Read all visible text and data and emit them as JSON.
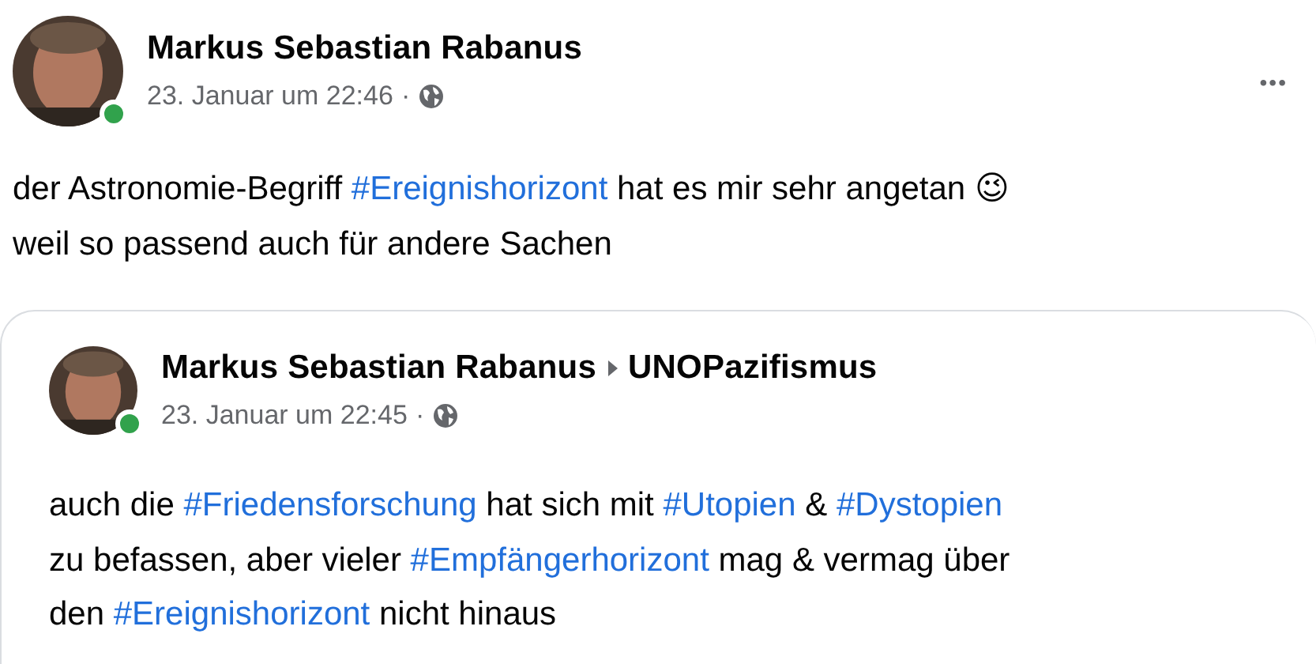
{
  "post": {
    "author": "Markus Sebastian Rabanus",
    "online": true,
    "date": "23. Januar um 22:46",
    "separator": "·",
    "more": "•••",
    "text": [
      {
        "kind": "plain",
        "text": "der Astronomie-Begriff "
      },
      {
        "kind": "hashtag",
        "text": "#Ereignishorizont"
      },
      {
        "kind": "plain",
        "text": " hat es mir sehr angetan 😉"
      },
      {
        "kind": "break"
      },
      {
        "kind": "plain",
        "text": "weil so passend auch für andere Sachen"
      }
    ]
  },
  "shared_post": {
    "author": "Markus Sebastian Rabanus",
    "group": "UNOPazifismus",
    "online": true,
    "date": "23. Januar um 22:45",
    "separator": "·",
    "text": [
      {
        "kind": "plain",
        "text": "auch die "
      },
      {
        "kind": "hashtag",
        "text": "#Friedensforschung"
      },
      {
        "kind": "plain",
        "text": " hat sich mit "
      },
      {
        "kind": "hashtag",
        "text": "#Utopien"
      },
      {
        "kind": "plain",
        "text": " & "
      },
      {
        "kind": "hashtag",
        "text": "#Dystopien"
      },
      {
        "kind": "break"
      },
      {
        "kind": "plain",
        "text": "zu befassen, aber vieler "
      },
      {
        "kind": "hashtag",
        "text": "#Empfängerhorizont"
      },
      {
        "kind": "plain",
        "text": " mag & vermag über"
      },
      {
        "kind": "break"
      },
      {
        "kind": "plain",
        "text": "den "
      },
      {
        "kind": "hashtag",
        "text": "#Ereignishorizont"
      },
      {
        "kind": "plain",
        "text": " nicht hinaus"
      }
    ]
  }
}
